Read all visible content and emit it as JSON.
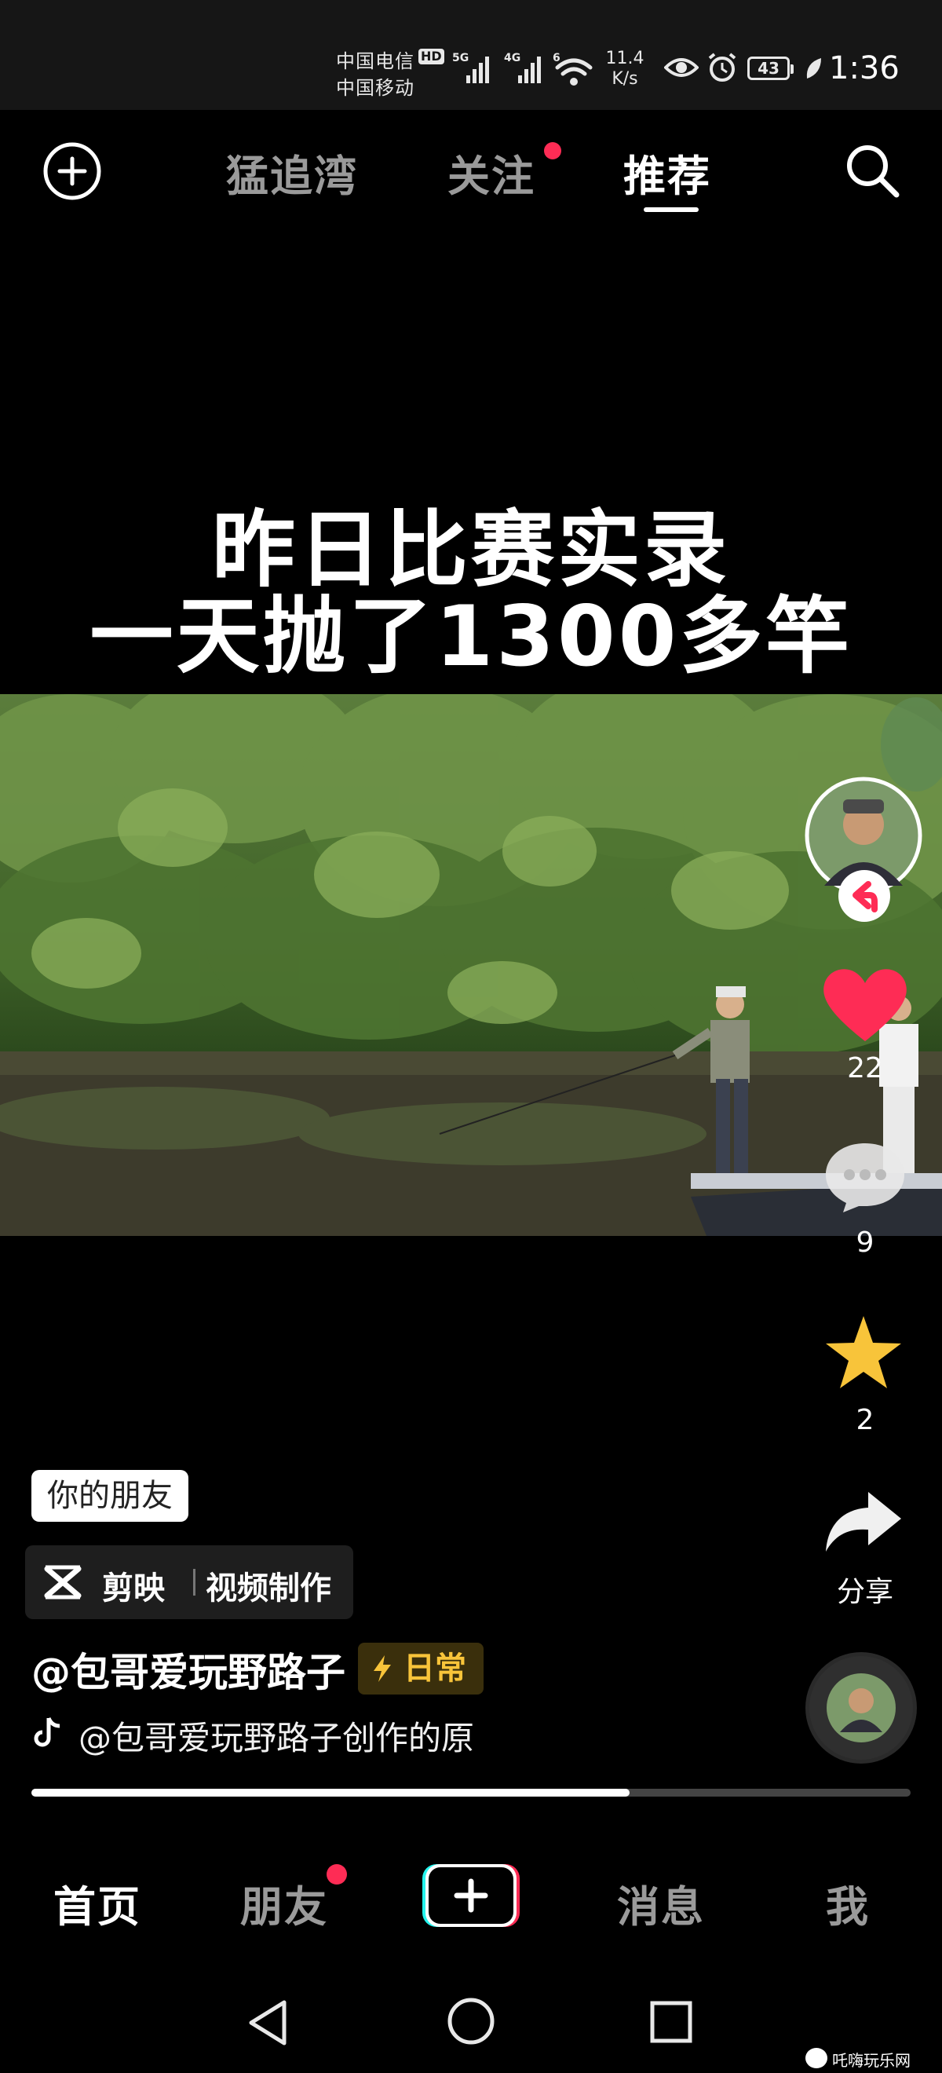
{
  "status_bar": {
    "carrier_1": "中国电信",
    "hd_badge": "HD",
    "carrier_2": "中国移动",
    "signal_1_label": "5G",
    "signal_2_label": "4G",
    "wifi_label": "6",
    "net_speed_value": "11.4",
    "net_speed_unit": "K/s",
    "battery_level": "43",
    "time": "1:36"
  },
  "top_nav": {
    "tabs": [
      {
        "label": "猛追湾"
      },
      {
        "label": "关注"
      },
      {
        "label": "推荐"
      }
    ],
    "active_tab": "推荐",
    "follow_has_dot": true
  },
  "video": {
    "caption_line_1": "昨日比赛实录",
    "caption_line_2": "一天抛了1300多竿"
  },
  "actions": {
    "likes": "22",
    "comments": "9",
    "favorites": "2",
    "share_label": "分享"
  },
  "info": {
    "friend_tag": "你的朋友",
    "capcut_brand": "剪映",
    "capcut_label": "视频制作",
    "author": "@包哥爱玩野路子",
    "category_tag": "日常",
    "music": "@包哥爱玩野路子创作的原"
  },
  "progress": {
    "played_fraction": 0.68
  },
  "bottom_nav": {
    "items": [
      {
        "label": "首页"
      },
      {
        "label": "朋友"
      },
      {
        "label": "消息"
      },
      {
        "label": "我"
      }
    ],
    "friends_has_dot": true
  },
  "watermark": "吒嗨玩乐网",
  "colors": {
    "like_red": "#fe2c55",
    "favorite_yellow": "#f8c43a",
    "create_cyan": "#25f4ee"
  }
}
